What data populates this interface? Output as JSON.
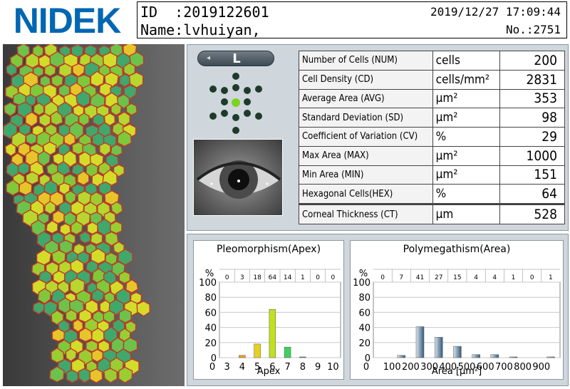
{
  "header": {
    "brand": "NIDEK",
    "id_label": "ID  :2019122601",
    "name_label": "Name:lvhuiyan,",
    "datetime": "2019/12/27 17:09:44",
    "number": "No.:2751"
  },
  "eye": {
    "label": "L",
    "arrow": "◂"
  },
  "results": [
    {
      "label": "Number of Cells (NUM)",
      "unit": "cells",
      "value": "200"
    },
    {
      "label": "Cell Density (CD)",
      "unit": "cells/mm²",
      "value": "2831"
    },
    {
      "label": "Average Area (AVG)",
      "unit": "μm²",
      "value": "353"
    },
    {
      "label": "Standard Deviation (SD)",
      "unit": "μm²",
      "value": "98"
    },
    {
      "label": "Coefficient of Variation (CV)",
      "unit": "%",
      "value": "29"
    },
    {
      "label": "Max Area (MAX)",
      "unit": "μm²",
      "value": "1000"
    },
    {
      "label": "Min Area (MIN)",
      "unit": "μm²",
      "value": "151"
    },
    {
      "label": "Hexagonal Cells(HEX)",
      "unit": "%",
      "value": "64"
    }
  ],
  "thickness": {
    "label": "Corneal Thickness (CT)",
    "unit": "μm",
    "value": "528"
  },
  "colors": {
    "logo": "#0067b1",
    "panel": "#cfd6dc"
  },
  "chart_data": [
    {
      "type": "bar",
      "title": "Pleomorphism(Apex)",
      "xlabel": "Apex",
      "ylabel": "%",
      "categories": [
        "3",
        "4",
        "5",
        "6",
        "7",
        "8",
        "9",
        "10"
      ],
      "counts": [
        "0",
        "3",
        "18",
        "64",
        "14",
        "1",
        "0",
        "0"
      ],
      "values": [
        0,
        3,
        18,
        64,
        14,
        1,
        0,
        0
      ],
      "ylim": [
        0,
        100
      ],
      "yticks": [
        "0",
        "20",
        "40",
        "60",
        "80",
        "100"
      ],
      "xticks": [
        "3",
        "4",
        "5",
        "6",
        "7",
        "8",
        "9",
        "10"
      ],
      "grid": true
    },
    {
      "type": "bar",
      "title": "Polymegathism(Area)",
      "xlabel": "Area [μm²]",
      "ylabel": "%",
      "categories": [
        "<100",
        "100",
        "200",
        "300",
        "400",
        "500",
        "600",
        "700",
        "800",
        "900"
      ],
      "counts": [
        "0",
        "7",
        "41",
        "27",
        "15",
        "4",
        "4",
        "1",
        "0",
        "1"
      ],
      "values": [
        0,
        3,
        41,
        27,
        15,
        4,
        4,
        1,
        0,
        1
      ],
      "ylim": [
        0,
        100
      ],
      "yticks": [
        "0",
        "20",
        "40",
        "60",
        "80",
        "100"
      ],
      "xticks": [
        "100",
        "200",
        "300",
        "400",
        "500",
        "600",
        "700",
        "800",
        "900"
      ],
      "grid": true
    }
  ]
}
